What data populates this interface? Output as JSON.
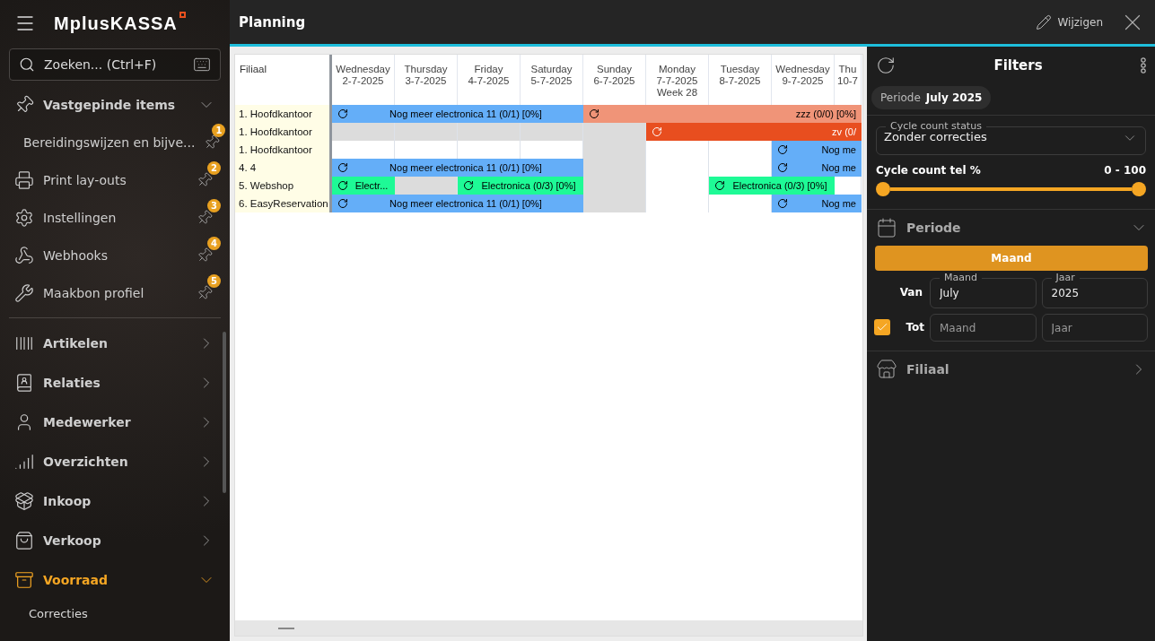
{
  "sidebar": {
    "logo": "MplusKASSA",
    "search": {
      "placeholder": "Zoeken... (Ctrl+F)"
    },
    "pinned": {
      "title": "Vastgepinde items",
      "expanded": true,
      "items": [
        {
          "label": "Bereidingswijzen en bijve...",
          "kind": "barcode",
          "badge": "1"
        },
        {
          "label": "Print lay-outs",
          "kind": "printer",
          "badge": "2"
        },
        {
          "label": "Instellingen",
          "kind": "settings",
          "badge": "3"
        },
        {
          "label": "Webhooks",
          "kind": "webhook",
          "badge": "4"
        },
        {
          "label": "Maakbon profiel",
          "kind": "tools",
          "badge": "5"
        }
      ]
    },
    "nav": [
      {
        "label": "Artikelen",
        "kind": "barcode",
        "selected": false,
        "expanded": false
      },
      {
        "label": "Relaties",
        "kind": "contacts",
        "selected": false,
        "expanded": false
      },
      {
        "label": "Medewerker",
        "kind": "user",
        "selected": false,
        "expanded": false
      },
      {
        "label": "Overzichten",
        "kind": "chart",
        "selected": false,
        "expanded": false
      },
      {
        "label": "Inkoop",
        "kind": "inbox",
        "selected": false,
        "expanded": false
      },
      {
        "label": "Verkoop",
        "kind": "bag",
        "selected": false,
        "expanded": false
      },
      {
        "label": "Voorraad",
        "kind": "archive",
        "selected": true,
        "expanded": true,
        "children": [
          {
            "label": "Correcties"
          }
        ]
      }
    ]
  },
  "header": {
    "title": "Planning",
    "edit_button": "Wijzigen"
  },
  "planning": {
    "branch_header": "Filiaal",
    "days": [
      {
        "weekday": "Wednesday",
        "date": "2-7-2025"
      },
      {
        "weekday": "Thursday",
        "date": "3-7-2025"
      },
      {
        "weekday": "Friday",
        "date": "4-7-2025"
      },
      {
        "weekday": "Saturday",
        "date": "5-7-2025"
      },
      {
        "weekday": "Sunday",
        "date": "6-7-2025"
      },
      {
        "weekday": "Monday",
        "date": "7-7-2025",
        "week": "Week 28"
      },
      {
        "weekday": "Tuesday",
        "date": "8-7-2025"
      },
      {
        "weekday": "Wednesday",
        "date": "9-7-2025"
      },
      {
        "weekday": "Thu",
        "date": "10-7"
      }
    ],
    "rows": [
      {
        "branch": "1. Hoofdkantoor",
        "slots": [
          {
            "kind": "bar",
            "label": "Nog meer electronica 11 (0/1) [0%]",
            "color": "#64aef8"
          },
          {
            "kind": "continued"
          },
          {
            "kind": "continued"
          },
          {
            "kind": "continued"
          },
          {
            "kind": "bar",
            "label": "zzz (0/0) [0%]",
            "color": "#f09478"
          },
          {
            "kind": "continued"
          },
          {
            "kind": "continued"
          },
          {
            "kind": "continued"
          },
          {
            "kind": "continued"
          }
        ]
      },
      {
        "branch": "1. Hoofdkantoor",
        "slots": [
          {
            "kind": "empty",
            "shaded": true
          },
          {
            "kind": "empty",
            "shaded": true
          },
          {
            "kind": "empty",
            "shaded": true
          },
          {
            "kind": "empty",
            "shaded": true
          },
          {
            "kind": "empty",
            "shaded": true
          },
          {
            "kind": "bar",
            "label": "zv (0/",
            "color": "#e84e1f"
          },
          {
            "kind": "continued"
          },
          {
            "kind": "continued"
          },
          {
            "kind": "continued"
          }
        ]
      },
      {
        "branch": "1. Hoofdkantoor",
        "slots": [
          {
            "kind": "empty",
            "shaded": false
          },
          {
            "kind": "empty",
            "shaded": false
          },
          {
            "kind": "empty",
            "shaded": false
          },
          {
            "kind": "empty",
            "shaded": false
          },
          {
            "kind": "empty",
            "shaded": true
          },
          {
            "kind": "empty",
            "shaded": false
          },
          {
            "kind": "empty",
            "shaded": false
          },
          {
            "kind": "bar",
            "label": "Nog me",
            "color": "#64aef8"
          },
          {
            "kind": "continued"
          }
        ]
      },
      {
        "branch": "4. 4",
        "slots": [
          {
            "kind": "bar",
            "label": "Nog meer electronica 11 (0/1) [0%]",
            "color": "#64aef8"
          },
          {
            "kind": "continued"
          },
          {
            "kind": "continued"
          },
          {
            "kind": "continued"
          },
          {
            "kind": "empty",
            "shaded": true
          },
          {
            "kind": "empty",
            "shaded": false
          },
          {
            "kind": "empty",
            "shaded": false
          },
          {
            "kind": "bar",
            "label": "Nog me",
            "color": "#64aef8"
          },
          {
            "kind": "continued"
          }
        ]
      },
      {
        "branch": "5. Webshop",
        "slots": [
          {
            "kind": "bar",
            "label": "Electr...",
            "color": "#1efa96"
          },
          {
            "kind": "empty",
            "shaded": true
          },
          {
            "kind": "bar",
            "label": "Electronica (0/3) [0%]",
            "color": "#1efa96"
          },
          {
            "kind": "continued"
          },
          {
            "kind": "empty",
            "shaded": true
          },
          {
            "kind": "empty",
            "shaded": false
          },
          {
            "kind": "bar",
            "label": "Electronica (0/3) [0%]",
            "color": "#1efa96"
          },
          {
            "kind": "continued"
          },
          {
            "kind": "empty",
            "shaded": false
          }
        ]
      },
      {
        "branch": "6. EasyReservation",
        "slots": [
          {
            "kind": "bar",
            "label": "Nog meer electronica 11 (0/1) [0%]",
            "color": "#64aef8"
          },
          {
            "kind": "continued"
          },
          {
            "kind": "continued"
          },
          {
            "kind": "continued"
          },
          {
            "kind": "empty",
            "shaded": true
          },
          {
            "kind": "empty",
            "shaded": false
          },
          {
            "kind": "empty",
            "shaded": false
          },
          {
            "kind": "bar",
            "label": "Nog me",
            "color": "#64aef8"
          },
          {
            "kind": "continued"
          }
        ]
      }
    ]
  },
  "filters": {
    "title": "Filters",
    "chip": {
      "label": "Periode",
      "value": "July 2025"
    },
    "status_select": {
      "legend": "Cycle count status",
      "value": "Zonder correcties"
    },
    "range": {
      "label": "Cycle count tel %",
      "reading": "0 - 100",
      "low": {
        "level": 0
      },
      "high": {
        "level": 1
      }
    },
    "period": {
      "title": "Periode",
      "expanded": true,
      "mode_button": "Maand",
      "from": {
        "label": "Van",
        "month": {
          "legend": "Maand",
          "value": "July"
        },
        "year": {
          "legend": "Jaar",
          "value": "2025"
        }
      },
      "to": {
        "label": "Tot",
        "checked": true,
        "month": {
          "placeholder": "Maand"
        },
        "year": {
          "placeholder": "Jaar"
        }
      }
    },
    "branch_section": {
      "title": "Filiaal",
      "expanded": false
    }
  }
}
